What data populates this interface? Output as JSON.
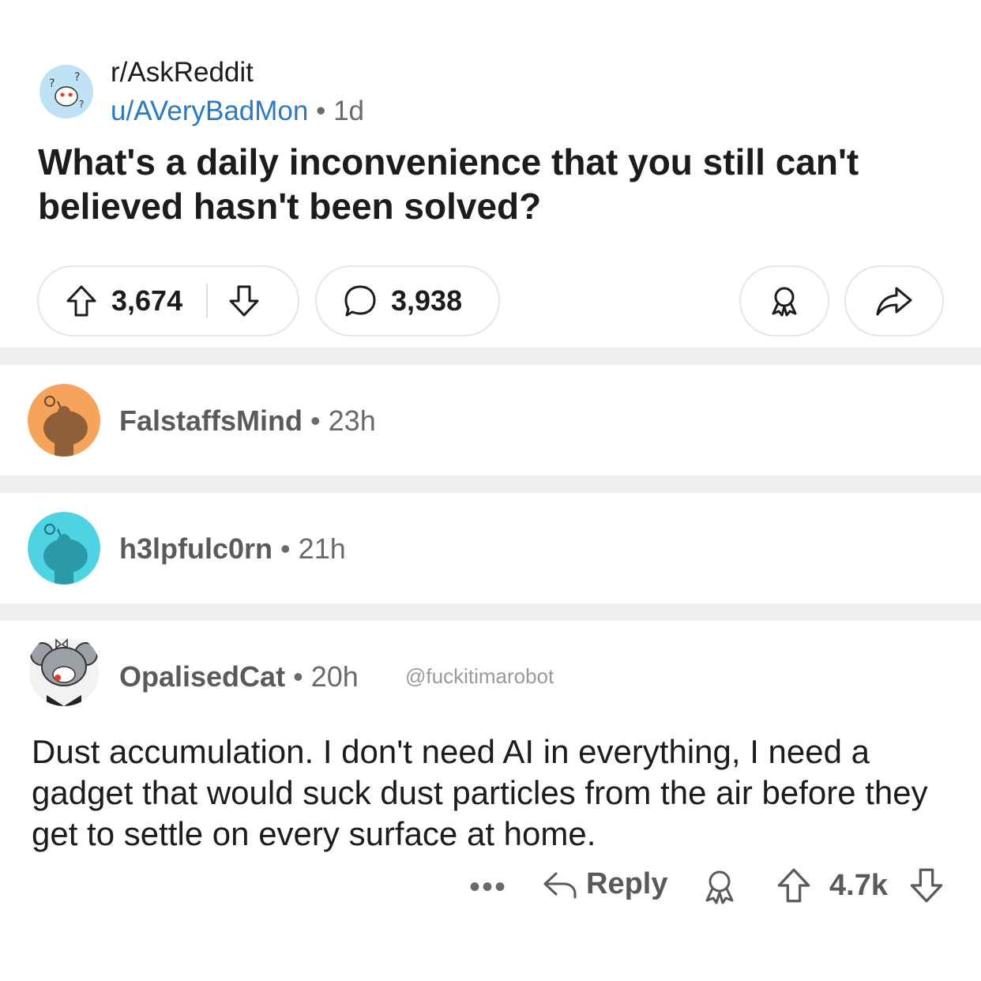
{
  "post": {
    "subreddit": "r/AskReddit",
    "author": "u/AVeryBadMon",
    "separator": "•",
    "age": "1d",
    "title": "What's a daily inconvenience that you still can't believed hasn't been solved?",
    "score": "3,674",
    "comment_count": "3,938"
  },
  "comments": [
    {
      "author": "FalstaffsMind",
      "age": "23h",
      "avatar_color": "#f6a35b"
    },
    {
      "author": "h3lpfulc0rn",
      "age": "21h",
      "avatar_color": "#4fd3e3"
    },
    {
      "author": "OpalisedCat",
      "age": "20h",
      "body": "Dust accumulation. I don't need AI in everything, I need a gadget that would suck dust particles from the air before they get to settle on every surface at home.",
      "score": "4.7k",
      "reply_label": "Reply",
      "more_label": "•••"
    }
  ],
  "watermark": "@fuckitimarobot",
  "icons": {
    "upvote": "arrow-up-outline",
    "downvote": "arrow-down-outline",
    "comment": "speech-bubble",
    "award": "award-ribbon",
    "share": "share-arrow",
    "reply": "reply-arrow",
    "more": "three-dots"
  },
  "colors": {
    "link_blue": "#2a7bbf",
    "divider": "#eeeff1",
    "text": "#1c1c1c",
    "muted": "#6a6a6a"
  }
}
